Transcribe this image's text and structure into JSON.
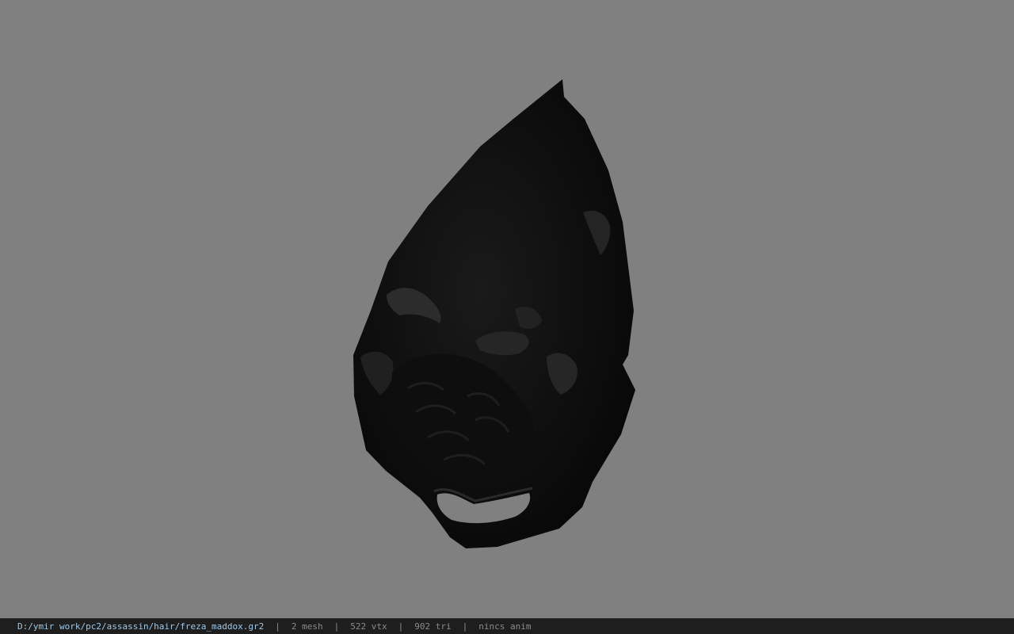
{
  "viewer": {
    "background_color": "#808080",
    "model_icon": "hair-mesh-model"
  },
  "statusbar": {
    "file_path": "D:/ymir work/pc2/assassin/hair/freza_maddox.gr2",
    "separator": "|",
    "mesh_count": "2 mesh",
    "vertex_count": "522 vtx",
    "triangle_count": "902 tri",
    "anim_status": "nincs anim"
  }
}
